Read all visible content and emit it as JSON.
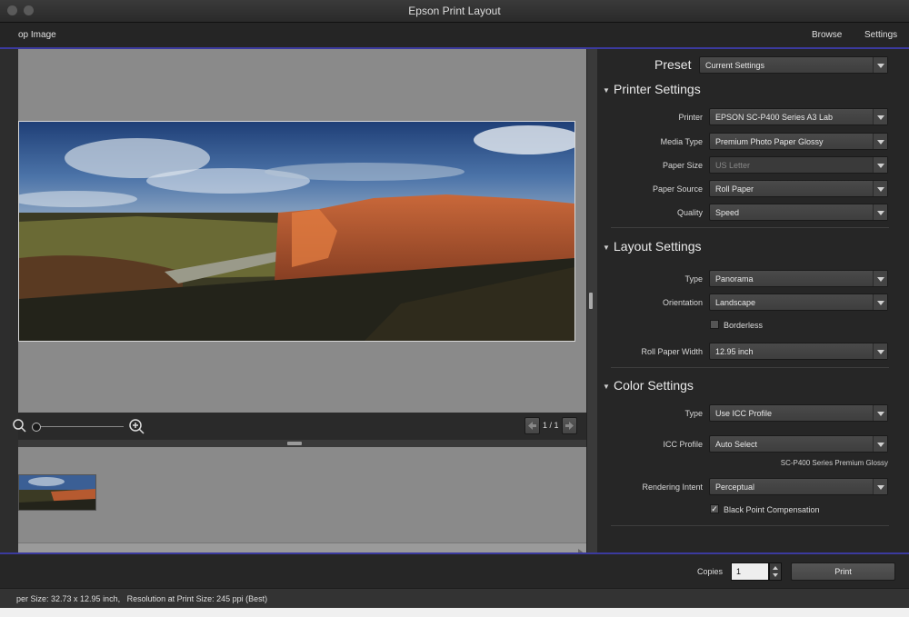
{
  "window": {
    "title": "Epson Print Layout"
  },
  "toolbar": {
    "left_label": "op Image",
    "browse_label": "Browse",
    "settings_label": "Settings"
  },
  "preview": {
    "page_indicator": "1 / 1",
    "zoom_level": 0.0,
    "icons": {
      "zoom_out": "zoom-out-icon",
      "zoom_in": "zoom-in-icon",
      "prev": "left-arrow-icon",
      "next": "right-arrow-icon"
    }
  },
  "settings": {
    "preset_label": "Preset",
    "preset_value": "Current Settings",
    "printer_section": {
      "title": "Printer Settings",
      "printer_label": "Printer",
      "printer_value": "EPSON SC-P400 Series A3 Lab",
      "media_type_label": "Media Type",
      "media_type_value": "Premium Photo Paper Glossy",
      "paper_size_label": "Paper Size",
      "paper_size_value": "US Letter",
      "paper_source_label": "Paper Source",
      "paper_source_value": "Roll Paper",
      "quality_label": "Quality",
      "quality_value": "Speed"
    },
    "layout_section": {
      "title": "Layout Settings",
      "type_label": "Type",
      "type_value": "Panorama",
      "orientation_label": "Orientation",
      "orientation_value": "Landscape",
      "borderless_label": "Borderless",
      "borderless_checked": false,
      "roll_width_label": "Roll Paper Width",
      "roll_width_value": "12.95 inch"
    },
    "color_section": {
      "title": "Color Settings",
      "type_label": "Type",
      "type_value": "Use ICC Profile",
      "icc_label": "ICC Profile",
      "icc_value": "Auto Select",
      "icc_note": "SC-P400 Series Premium Glossy",
      "intent_label": "Rendering Intent",
      "intent_value": "Perceptual",
      "bpc_label": "Black Point Compensation",
      "bpc_checked": true
    }
  },
  "bottom": {
    "copies_label": "Copies",
    "copies_value": "1",
    "print_label": "Print",
    "status_text": "per Size: 32.73 x 12.95 inch,   Resolution at Print Size: 245 ppi (Best)"
  },
  "colors": {
    "accent_blue": "#3b3a9e",
    "panel_bg": "#262626",
    "preview_bg": "#8a8a8a"
  }
}
